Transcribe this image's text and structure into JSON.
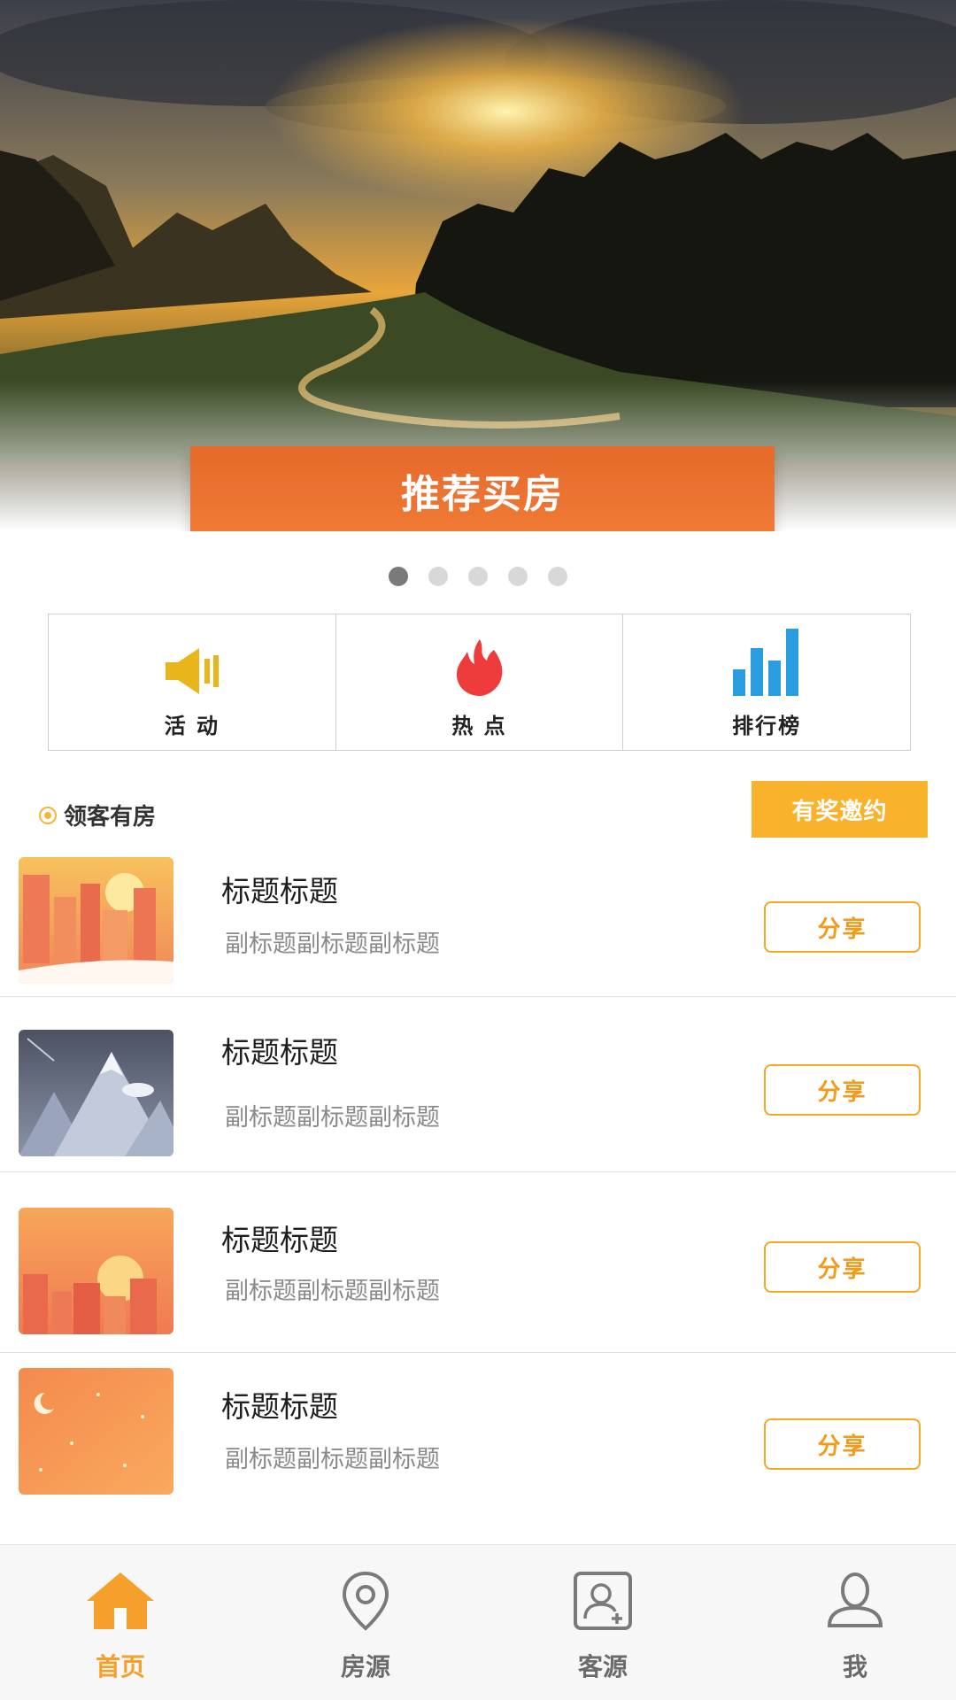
{
  "banner": {
    "cta_label": "推荐买房",
    "slides": 5,
    "active_slide": 1
  },
  "quick_nav": [
    {
      "label": "活 动",
      "icon": "speaker-icon",
      "color": "#e8b51a"
    },
    {
      "label": "热 点",
      "icon": "flame-icon",
      "color": "#ee3b3b"
    },
    {
      "label": "排行榜",
      "icon": "bar-chart-icon",
      "color": "#2a9de0"
    }
  ],
  "section": {
    "title": "领客有房",
    "invite_label": "有奖邀约"
  },
  "list": [
    {
      "title": "标题标题",
      "subtitle": "副标题副标题副标题",
      "share_label": "分享",
      "thumb": "city-sunset-thumb"
    },
    {
      "title": "标题标题",
      "subtitle": "副标题副标题副标题",
      "share_label": "分享",
      "thumb": "mountain-thumb"
    },
    {
      "title": "标题标题",
      "subtitle": "副标题副标题副标题",
      "share_label": "分享",
      "thumb": "city-sun-thumb"
    },
    {
      "title": "标题标题",
      "subtitle": "副标题副标题副标题",
      "share_label": "分享",
      "thumb": "night-sky-thumb"
    }
  ],
  "tabbar": [
    {
      "label": "首页",
      "icon": "home-icon",
      "active": true
    },
    {
      "label": "房源",
      "icon": "location-pin-icon",
      "active": false
    },
    {
      "label": "客源",
      "icon": "add-contact-icon",
      "active": false
    },
    {
      "label": "我",
      "icon": "user-icon",
      "active": false
    }
  ],
  "colors": {
    "accent": "#f5a623",
    "cta": "#ec7030",
    "invite": "#f8b22c"
  }
}
